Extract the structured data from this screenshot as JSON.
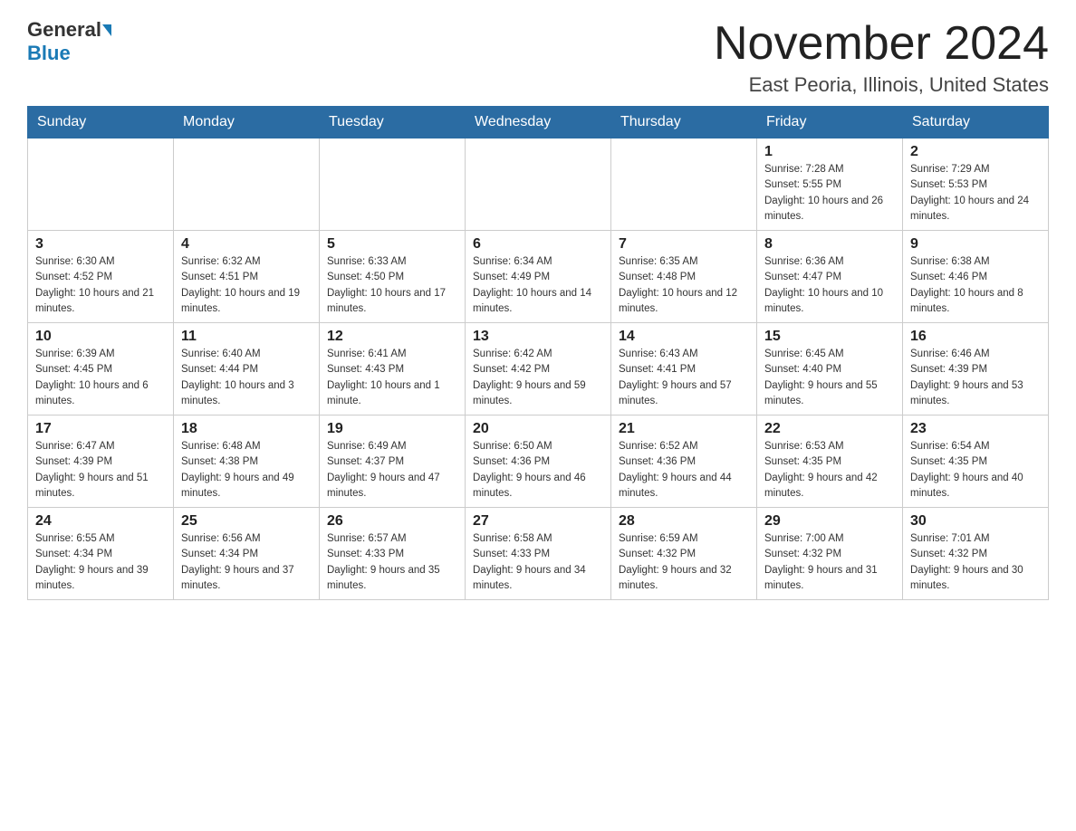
{
  "header": {
    "logo_general": "General",
    "logo_blue": "Blue",
    "month_title": "November 2024",
    "location": "East Peoria, Illinois, United States"
  },
  "weekdays": [
    "Sunday",
    "Monday",
    "Tuesday",
    "Wednesday",
    "Thursday",
    "Friday",
    "Saturday"
  ],
  "weeks": [
    [
      {
        "day": "",
        "sunrise": "",
        "sunset": "",
        "daylight": ""
      },
      {
        "day": "",
        "sunrise": "",
        "sunset": "",
        "daylight": ""
      },
      {
        "day": "",
        "sunrise": "",
        "sunset": "",
        "daylight": ""
      },
      {
        "day": "",
        "sunrise": "",
        "sunset": "",
        "daylight": ""
      },
      {
        "day": "",
        "sunrise": "",
        "sunset": "",
        "daylight": ""
      },
      {
        "day": "1",
        "sunrise": "Sunrise: 7:28 AM",
        "sunset": "Sunset: 5:55 PM",
        "daylight": "Daylight: 10 hours and 26 minutes."
      },
      {
        "day": "2",
        "sunrise": "Sunrise: 7:29 AM",
        "sunset": "Sunset: 5:53 PM",
        "daylight": "Daylight: 10 hours and 24 minutes."
      }
    ],
    [
      {
        "day": "3",
        "sunrise": "Sunrise: 6:30 AM",
        "sunset": "Sunset: 4:52 PM",
        "daylight": "Daylight: 10 hours and 21 minutes."
      },
      {
        "day": "4",
        "sunrise": "Sunrise: 6:32 AM",
        "sunset": "Sunset: 4:51 PM",
        "daylight": "Daylight: 10 hours and 19 minutes."
      },
      {
        "day": "5",
        "sunrise": "Sunrise: 6:33 AM",
        "sunset": "Sunset: 4:50 PM",
        "daylight": "Daylight: 10 hours and 17 minutes."
      },
      {
        "day": "6",
        "sunrise": "Sunrise: 6:34 AM",
        "sunset": "Sunset: 4:49 PM",
        "daylight": "Daylight: 10 hours and 14 minutes."
      },
      {
        "day": "7",
        "sunrise": "Sunrise: 6:35 AM",
        "sunset": "Sunset: 4:48 PM",
        "daylight": "Daylight: 10 hours and 12 minutes."
      },
      {
        "day": "8",
        "sunrise": "Sunrise: 6:36 AM",
        "sunset": "Sunset: 4:47 PM",
        "daylight": "Daylight: 10 hours and 10 minutes."
      },
      {
        "day": "9",
        "sunrise": "Sunrise: 6:38 AM",
        "sunset": "Sunset: 4:46 PM",
        "daylight": "Daylight: 10 hours and 8 minutes."
      }
    ],
    [
      {
        "day": "10",
        "sunrise": "Sunrise: 6:39 AM",
        "sunset": "Sunset: 4:45 PM",
        "daylight": "Daylight: 10 hours and 6 minutes."
      },
      {
        "day": "11",
        "sunrise": "Sunrise: 6:40 AM",
        "sunset": "Sunset: 4:44 PM",
        "daylight": "Daylight: 10 hours and 3 minutes."
      },
      {
        "day": "12",
        "sunrise": "Sunrise: 6:41 AM",
        "sunset": "Sunset: 4:43 PM",
        "daylight": "Daylight: 10 hours and 1 minute."
      },
      {
        "day": "13",
        "sunrise": "Sunrise: 6:42 AM",
        "sunset": "Sunset: 4:42 PM",
        "daylight": "Daylight: 9 hours and 59 minutes."
      },
      {
        "day": "14",
        "sunrise": "Sunrise: 6:43 AM",
        "sunset": "Sunset: 4:41 PM",
        "daylight": "Daylight: 9 hours and 57 minutes."
      },
      {
        "day": "15",
        "sunrise": "Sunrise: 6:45 AM",
        "sunset": "Sunset: 4:40 PM",
        "daylight": "Daylight: 9 hours and 55 minutes."
      },
      {
        "day": "16",
        "sunrise": "Sunrise: 6:46 AM",
        "sunset": "Sunset: 4:39 PM",
        "daylight": "Daylight: 9 hours and 53 minutes."
      }
    ],
    [
      {
        "day": "17",
        "sunrise": "Sunrise: 6:47 AM",
        "sunset": "Sunset: 4:39 PM",
        "daylight": "Daylight: 9 hours and 51 minutes."
      },
      {
        "day": "18",
        "sunrise": "Sunrise: 6:48 AM",
        "sunset": "Sunset: 4:38 PM",
        "daylight": "Daylight: 9 hours and 49 minutes."
      },
      {
        "day": "19",
        "sunrise": "Sunrise: 6:49 AM",
        "sunset": "Sunset: 4:37 PM",
        "daylight": "Daylight: 9 hours and 47 minutes."
      },
      {
        "day": "20",
        "sunrise": "Sunrise: 6:50 AM",
        "sunset": "Sunset: 4:36 PM",
        "daylight": "Daylight: 9 hours and 46 minutes."
      },
      {
        "day": "21",
        "sunrise": "Sunrise: 6:52 AM",
        "sunset": "Sunset: 4:36 PM",
        "daylight": "Daylight: 9 hours and 44 minutes."
      },
      {
        "day": "22",
        "sunrise": "Sunrise: 6:53 AM",
        "sunset": "Sunset: 4:35 PM",
        "daylight": "Daylight: 9 hours and 42 minutes."
      },
      {
        "day": "23",
        "sunrise": "Sunrise: 6:54 AM",
        "sunset": "Sunset: 4:35 PM",
        "daylight": "Daylight: 9 hours and 40 minutes."
      }
    ],
    [
      {
        "day": "24",
        "sunrise": "Sunrise: 6:55 AM",
        "sunset": "Sunset: 4:34 PM",
        "daylight": "Daylight: 9 hours and 39 minutes."
      },
      {
        "day": "25",
        "sunrise": "Sunrise: 6:56 AM",
        "sunset": "Sunset: 4:34 PM",
        "daylight": "Daylight: 9 hours and 37 minutes."
      },
      {
        "day": "26",
        "sunrise": "Sunrise: 6:57 AM",
        "sunset": "Sunset: 4:33 PM",
        "daylight": "Daylight: 9 hours and 35 minutes."
      },
      {
        "day": "27",
        "sunrise": "Sunrise: 6:58 AM",
        "sunset": "Sunset: 4:33 PM",
        "daylight": "Daylight: 9 hours and 34 minutes."
      },
      {
        "day": "28",
        "sunrise": "Sunrise: 6:59 AM",
        "sunset": "Sunset: 4:32 PM",
        "daylight": "Daylight: 9 hours and 32 minutes."
      },
      {
        "day": "29",
        "sunrise": "Sunrise: 7:00 AM",
        "sunset": "Sunset: 4:32 PM",
        "daylight": "Daylight: 9 hours and 31 minutes."
      },
      {
        "day": "30",
        "sunrise": "Sunrise: 7:01 AM",
        "sunset": "Sunset: 4:32 PM",
        "daylight": "Daylight: 9 hours and 30 minutes."
      }
    ]
  ]
}
